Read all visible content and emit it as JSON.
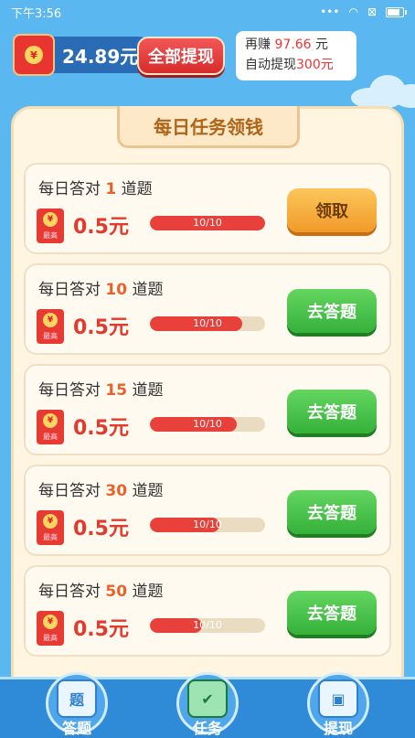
{
  "status_bar": {
    "time": "下午3:56"
  },
  "header": {
    "balance": "24.89元",
    "withdraw_all_label": "全部提现",
    "earn_more_prefix": "再赚",
    "earn_more_amount": "97.66",
    "earn_more_suffix": "元",
    "auto_withdraw_prefix": "自动提现",
    "auto_withdraw_amount": "300元"
  },
  "panel": {
    "title": "每日任务领钱"
  },
  "tasks": [
    {
      "title_prefix": "每日答对",
      "count": "1",
      "title_suffix": "道题",
      "reward": "0.5元",
      "progress_text": "10/10",
      "progress": 1.0,
      "button": "领取",
      "button_type": "claim",
      "badge": "最高"
    },
    {
      "title_prefix": "每日答对",
      "count": "10",
      "title_suffix": "道题",
      "reward": "0.5元",
      "progress_text": "10/10",
      "progress": 0.8,
      "button": "去答题",
      "button_type": "go",
      "badge": "最高"
    },
    {
      "title_prefix": "每日答对",
      "count": "15",
      "title_suffix": "道题",
      "reward": "0.5元",
      "progress_text": "10/10",
      "progress": 0.75,
      "button": "去答题",
      "button_type": "go",
      "badge": "最高"
    },
    {
      "title_prefix": "每日答对",
      "count": "30",
      "title_suffix": "道题",
      "reward": "0.5元",
      "progress_text": "10/10",
      "progress": 0.6,
      "button": "去答题",
      "button_type": "go",
      "badge": "最高"
    },
    {
      "title_prefix": "每日答对",
      "count": "50",
      "title_suffix": "道题",
      "reward": "0.5元",
      "progress_text": "10/10",
      "progress": 0.45,
      "button": "去答题",
      "button_type": "go",
      "badge": "最高"
    }
  ],
  "bottom_nav": [
    {
      "label": "答题",
      "icon": "question-book-icon",
      "glyph": "题"
    },
    {
      "label": "任务",
      "icon": "clipboard-check-icon",
      "glyph": "✔"
    },
    {
      "label": "提现",
      "icon": "wallet-icon",
      "glyph": "▣"
    }
  ],
  "colors": {
    "background": "#5bb7ef",
    "accent_red": "#e33a2e",
    "go_green": "#35b139",
    "claim_orange": "#f19a28"
  }
}
